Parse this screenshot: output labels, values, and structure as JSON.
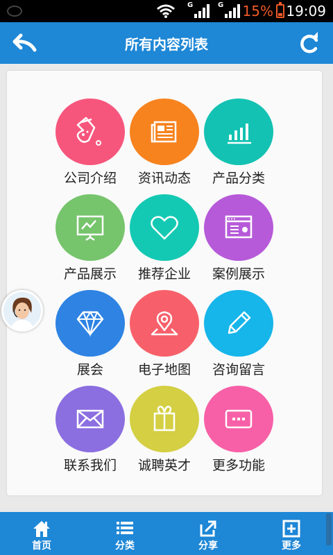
{
  "status_bar": {
    "battery_percent": "15%",
    "time": "19:09",
    "network": "G"
  },
  "header": {
    "title": "所有内容列表",
    "back_icon": "back-arrow-icon",
    "refresh_icon": "refresh-icon"
  },
  "grid": [
    {
      "label": "公司介绍",
      "color": "#f7567c",
      "icon": "flask-icon"
    },
    {
      "label": "资讯动态",
      "color": "#f7831f",
      "icon": "newspaper-icon"
    },
    {
      "label": "产品分类",
      "color": "#13c2b2",
      "icon": "bar-chart-icon"
    },
    {
      "label": "产品展示",
      "color": "#76c46c",
      "icon": "presentation-icon"
    },
    {
      "label": "推荐企业",
      "color": "#14c9b3",
      "icon": "heart-icon"
    },
    {
      "label": "案例展示",
      "color": "#b65ad9",
      "icon": "browser-window-icon"
    },
    {
      "label": "展会",
      "color": "#2e83e3",
      "icon": "diamond-icon"
    },
    {
      "label": "电子地图",
      "color": "#f7606a",
      "icon": "map-pin-icon"
    },
    {
      "label": "咨询留言",
      "color": "#16b5ea",
      "icon": "pencil-icon"
    },
    {
      "label": "联系我们",
      "color": "#8b6ee0",
      "icon": "envelope-icon"
    },
    {
      "label": "诚聘英才",
      "color": "#d4cf43",
      "icon": "gift-icon"
    },
    {
      "label": "更多功能",
      "color": "#f760a7",
      "icon": "more-dots-icon"
    }
  ],
  "bottom_tabs": [
    {
      "label": "首页",
      "icon": "home-icon"
    },
    {
      "label": "分类",
      "icon": "list-icon"
    },
    {
      "label": "分享",
      "icon": "share-icon"
    },
    {
      "label": "更多",
      "icon": "more-plus-icon"
    }
  ]
}
